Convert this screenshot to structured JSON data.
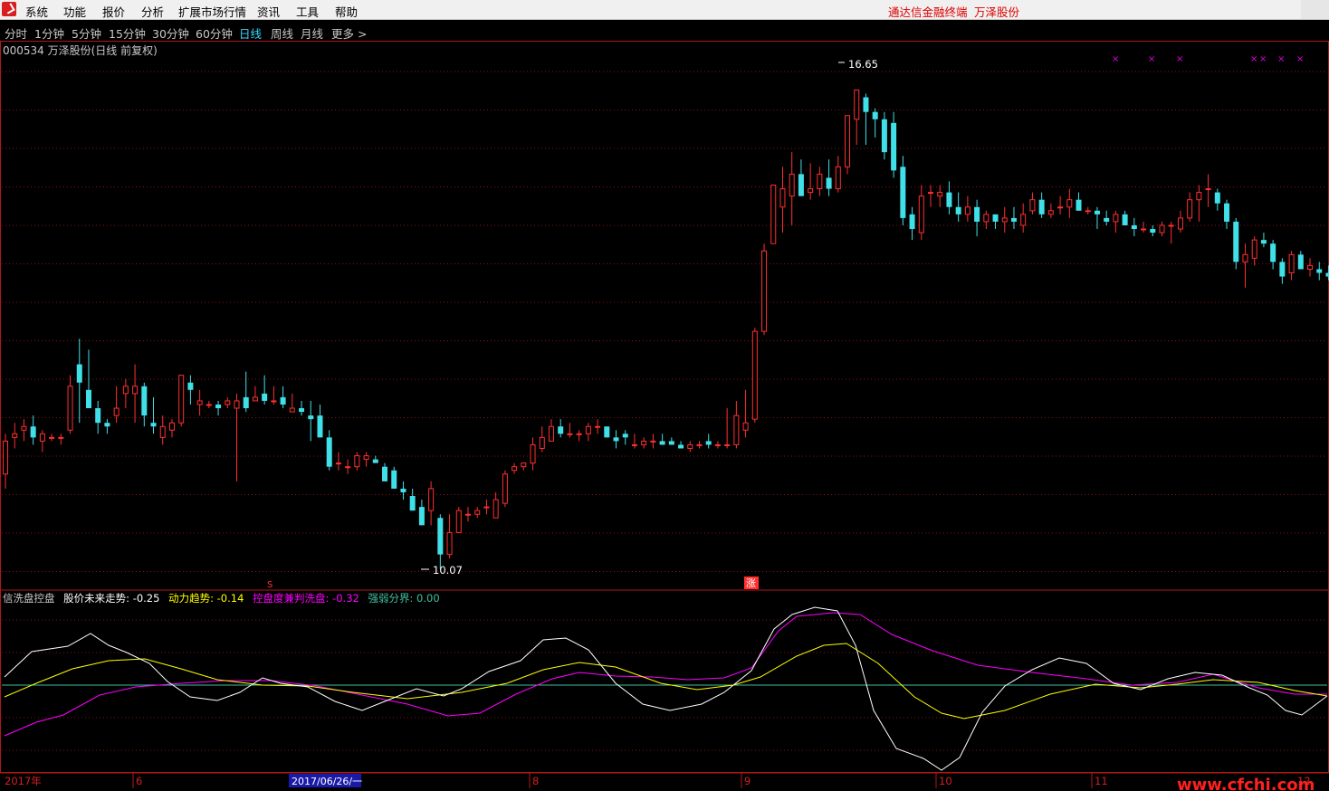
{
  "menu": {
    "items": [
      "系统",
      "功能",
      "报价",
      "分析",
      "扩展市场行情",
      "资讯",
      "工具",
      "帮助"
    ],
    "right_texts": [
      "通达信金融终端",
      "万泽股份"
    ]
  },
  "timeframes": {
    "items": [
      "分时",
      "1分钟",
      "5分钟",
      "15分钟",
      "30分钟",
      "60分钟",
      "日线",
      "周线",
      "月线",
      "更多 >"
    ],
    "active": "日线"
  },
  "stock": {
    "header": "000534 万泽股份(日线 前复权)",
    "max_label": "16.65",
    "min_label": "10.07"
  },
  "markers": {
    "s": "S",
    "zhang": "涨"
  },
  "indicator": {
    "name": "信洗盘控盘",
    "lines": [
      {
        "label": "股价未来走势:",
        "value": "-0.25",
        "color": "#ffffff"
      },
      {
        "label": "动力趋势:",
        "value": "-0.14",
        "color": "#ffff00"
      },
      {
        "label": "控盘度兼判洗盘:",
        "value": "-0.32",
        "color": "#ff00ff"
      },
      {
        "label": "强弱分界:",
        "value": "0.00",
        "color": "#40c0a0"
      }
    ]
  },
  "xaxis": {
    "labels": [
      "2017年",
      "6",
      "2017/06/26/一",
      "8",
      "9",
      "10",
      "11",
      "12"
    ],
    "watermark": "www.cfchi.com"
  },
  "colors": {
    "up": "#ff3030",
    "down": "#40e0e8",
    "grid": "#8b1010"
  },
  "chart_data": {
    "type": "candlestick",
    "ylim": [
      9.9,
      17.2
    ],
    "candles": [
      [
        11.4,
        11.2,
        11.95,
        11.85
      ],
      [
        11.9,
        11.75,
        12.1,
        11.95
      ],
      [
        12.0,
        11.85,
        12.15,
        12.05
      ],
      [
        12.05,
        11.8,
        12.2,
        11.9
      ],
      [
        11.85,
        11.7,
        12.0,
        11.95
      ],
      [
        11.9,
        11.85,
        11.95,
        11.9
      ],
      [
        11.9,
        11.8,
        11.95,
        11.9
      ],
      [
        12.0,
        11.95,
        12.75,
        12.6
      ],
      [
        12.9,
        12.1,
        13.25,
        12.65
      ],
      [
        12.55,
        12.35,
        13.1,
        12.3
      ],
      [
        12.3,
        11.95,
        12.4,
        12.1
      ],
      [
        12.1,
        11.95,
        12.15,
        12.05
      ],
      [
        12.2,
        12.1,
        12.6,
        12.3
      ],
      [
        12.5,
        12.3,
        12.7,
        12.6
      ],
      [
        12.5,
        12.1,
        12.9,
        12.6
      ],
      [
        12.6,
        12.05,
        12.65,
        12.2
      ],
      [
        12.1,
        11.95,
        12.45,
        12.05
      ],
      [
        11.9,
        11.8,
        12.2,
        12.05
      ],
      [
        12.0,
        11.9,
        12.15,
        12.1
      ],
      [
        12.1,
        12.05,
        12.75,
        12.75
      ],
      [
        12.65,
        12.35,
        12.75,
        12.55
      ],
      [
        12.35,
        12.2,
        12.55,
        12.4
      ],
      [
        12.35,
        12.3,
        12.4,
        12.35
      ],
      [
        12.35,
        12.2,
        12.4,
        12.3
      ],
      [
        12.35,
        12.3,
        12.45,
        12.4
      ],
      [
        12.3,
        11.3,
        12.5,
        12.4
      ],
      [
        12.45,
        12.25,
        12.8,
        12.3
      ],
      [
        12.4,
        12.4,
        12.6,
        12.45
      ],
      [
        12.5,
        12.35,
        12.75,
        12.4
      ],
      [
        12.4,
        12.35,
        12.6,
        12.4
      ],
      [
        12.45,
        12.3,
        12.6,
        12.35
      ],
      [
        12.25,
        12.25,
        12.5,
        12.3
      ],
      [
        12.3,
        12.2,
        12.4,
        12.25
      ],
      [
        12.2,
        11.85,
        12.4,
        12.15
      ],
      [
        12.2,
        11.9,
        12.35,
        11.9
      ],
      [
        11.9,
        11.45,
        12.0,
        11.5
      ],
      [
        11.55,
        11.45,
        11.7,
        11.55
      ],
      [
        11.5,
        11.4,
        11.6,
        11.5
      ],
      [
        11.5,
        11.45,
        11.7,
        11.65
      ],
      [
        11.6,
        11.5,
        11.7,
        11.65
      ],
      [
        11.6,
        11.55,
        11.65,
        11.55
      ],
      [
        11.5,
        11.3,
        11.55,
        11.3
      ],
      [
        11.45,
        11.2,
        11.5,
        11.2
      ],
      [
        11.2,
        11.05,
        11.3,
        11.15
      ],
      [
        11.1,
        10.9,
        11.2,
        10.9
      ],
      [
        10.95,
        10.7,
        11.05,
        10.7
      ],
      [
        10.9,
        10.7,
        11.3,
        11.2
      ],
      [
        10.8,
        10.1,
        10.85,
        10.3
      ],
      [
        10.3,
        10.25,
        10.85,
        10.6
      ],
      [
        10.6,
        10.6,
        10.95,
        10.9
      ],
      [
        10.85,
        10.75,
        10.95,
        10.85
      ],
      [
        10.85,
        10.8,
        10.95,
        10.9
      ],
      [
        10.95,
        10.85,
        11.05,
        10.95
      ],
      [
        10.8,
        10.8,
        11.15,
        11.05
      ],
      [
        11.0,
        10.95,
        11.45,
        11.4
      ],
      [
        11.45,
        11.4,
        11.55,
        11.5
      ],
      [
        11.5,
        11.45,
        11.55,
        11.55
      ],
      [
        11.55,
        11.45,
        11.9,
        11.8
      ],
      [
        11.75,
        11.7,
        12.05,
        11.9
      ],
      [
        11.85,
        11.85,
        12.15,
        12.05
      ],
      [
        12.05,
        11.9,
        12.15,
        11.95
      ],
      [
        11.95,
        11.9,
        12.1,
        11.95
      ],
      [
        11.95,
        11.85,
        12.0,
        11.95
      ],
      [
        11.95,
        11.85,
        12.1,
        12.05
      ],
      [
        12.05,
        11.95,
        12.15,
        12.05
      ],
      [
        12.05,
        11.9,
        12.05,
        11.9
      ],
      [
        11.9,
        11.75,
        12.0,
        11.85
      ],
      [
        11.95,
        11.8,
        12.0,
        11.9
      ],
      [
        11.8,
        11.75,
        11.95,
        11.8
      ],
      [
        11.8,
        11.75,
        11.9,
        11.85
      ],
      [
        11.85,
        11.75,
        11.95,
        11.85
      ],
      [
        11.85,
        11.8,
        11.95,
        11.8
      ],
      [
        11.85,
        11.8,
        11.9,
        11.8
      ],
      [
        11.8,
        11.75,
        11.85,
        11.75
      ],
      [
        11.75,
        11.7,
        11.85,
        11.8
      ],
      [
        11.8,
        11.75,
        11.85,
        11.8
      ],
      [
        11.85,
        11.75,
        11.95,
        11.8
      ],
      [
        11.8,
        11.75,
        11.85,
        11.8
      ],
      [
        11.8,
        11.75,
        12.3,
        11.8
      ],
      [
        11.8,
        11.75,
        12.4,
        12.2
      ],
      [
        12.0,
        11.9,
        12.55,
        12.1
      ],
      [
        12.15,
        12.1,
        13.4,
        13.35
      ],
      [
        13.35,
        13.3,
        14.55,
        14.45
      ],
      [
        14.55,
        14.55,
        15.35,
        15.35
      ],
      [
        15.05,
        14.7,
        15.6,
        15.3
      ],
      [
        15.2,
        14.8,
        15.8,
        15.5
      ],
      [
        15.5,
        15.2,
        15.7,
        15.2
      ],
      [
        15.25,
        15.15,
        15.65,
        15.3
      ],
      [
        15.3,
        15.2,
        15.6,
        15.5
      ],
      [
        15.45,
        15.2,
        15.7,
        15.3
      ],
      [
        15.3,
        15.25,
        15.75,
        15.6
      ],
      [
        15.6,
        15.5,
        16.3,
        16.3
      ],
      [
        16.25,
        15.9,
        16.65,
        16.65
      ],
      [
        16.55,
        15.9,
        16.6,
        16.35
      ],
      [
        16.35,
        16.0,
        16.4,
        16.25
      ],
      [
        16.25,
        15.7,
        16.35,
        15.8
      ],
      [
        16.2,
        15.45,
        16.35,
        15.55
      ],
      [
        15.6,
        14.8,
        15.75,
        14.9
      ],
      [
        14.95,
        14.6,
        15.05,
        14.75
      ],
      [
        14.7,
        14.6,
        15.35,
        15.2
      ],
      [
        15.25,
        15.05,
        15.35,
        15.25
      ],
      [
        15.2,
        15.05,
        15.35,
        15.25
      ],
      [
        15.25,
        14.95,
        15.4,
        15.05
      ],
      [
        15.05,
        14.85,
        15.25,
        14.95
      ],
      [
        14.95,
        14.85,
        15.2,
        15.05
      ],
      [
        15.05,
        14.65,
        15.15,
        14.85
      ],
      [
        14.85,
        14.75,
        15.0,
        14.95
      ],
      [
        14.95,
        14.75,
        14.95,
        14.85
      ],
      [
        14.85,
        14.7,
        15.05,
        14.9
      ],
      [
        14.9,
        14.75,
        15.05,
        14.85
      ],
      [
        14.8,
        14.7,
        15.1,
        14.95
      ],
      [
        15.0,
        14.95,
        15.25,
        15.15
      ],
      [
        15.15,
        14.9,
        15.25,
        14.95
      ],
      [
        14.95,
        14.9,
        15.1,
        15.0
      ],
      [
        15.05,
        14.95,
        15.2,
        15.05
      ],
      [
        15.05,
        14.9,
        15.3,
        15.15
      ],
      [
        15.15,
        15.0,
        15.25,
        15.0
      ],
      [
        15.0,
        14.95,
        15.05,
        15.0
      ],
      [
        15.0,
        14.75,
        15.05,
        14.95
      ],
      [
        14.9,
        14.8,
        15.0,
        14.85
      ],
      [
        14.85,
        14.7,
        15.0,
        14.95
      ],
      [
        14.95,
        14.8,
        15.0,
        14.8
      ],
      [
        14.8,
        14.65,
        14.9,
        14.75
      ],
      [
        14.75,
        14.7,
        14.85,
        14.75
      ],
      [
        14.75,
        14.65,
        14.8,
        14.7
      ],
      [
        14.7,
        14.65,
        14.85,
        14.8
      ],
      [
        14.8,
        14.55,
        14.85,
        14.8
      ],
      [
        14.75,
        14.7,
        15.0,
        14.9
      ],
      [
        14.9,
        14.85,
        15.25,
        15.15
      ],
      [
        15.15,
        14.85,
        15.35,
        15.25
      ],
      [
        15.3,
        15.05,
        15.5,
        15.3
      ],
      [
        15.25,
        15.0,
        15.3,
        15.1
      ],
      [
        15.1,
        14.75,
        15.15,
        14.85
      ],
      [
        14.85,
        14.2,
        14.9,
        14.3
      ],
      [
        14.3,
        13.95,
        14.55,
        14.4
      ],
      [
        14.35,
        14.25,
        14.65,
        14.6
      ],
      [
        14.6,
        14.5,
        14.7,
        14.55
      ],
      [
        14.55,
        14.2,
        14.6,
        14.3
      ],
      [
        14.3,
        14.0,
        14.35,
        14.1
      ],
      [
        14.15,
        14.05,
        14.45,
        14.4
      ],
      [
        14.4,
        14.2,
        14.45,
        14.2
      ],
      [
        14.2,
        14.1,
        14.35,
        14.25
      ],
      [
        14.2,
        14.05,
        14.3,
        14.15
      ],
      [
        14.15,
        14.05,
        14.25,
        14.1
      ],
      [
        14.1,
        14.05,
        14.45,
        14.4
      ],
      [
        14.4,
        14.1,
        14.4,
        14.1
      ],
      [
        14.1,
        14.0,
        14.4,
        14.25
      ]
    ]
  }
}
